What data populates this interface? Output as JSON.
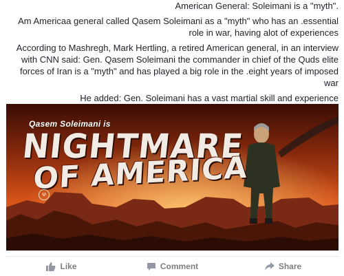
{
  "post": {
    "paragraphs": [
      ".\"American General: Soleimani is a \"myth",
      "Am Americaa general called Qasem Soleimani as a \"myth\" who has an .essential role in war, having alot of experiences",
      "According to Mashregh, Mark Hertling, a retired American general, in an interview with CNN said: Gen. Qasem Soleimani the commander in chief of the Quds elite forces of Iran is a \"myth\" and has played a big role in the .eight years of imposed war",
      "He added: Gen. Soleimani has a vast martial skill and experience"
    ]
  },
  "image": {
    "subtitle": "Qasem Soleimani is",
    "headline_line1": "NIGHTMARE",
    "headline_line2": "OF AMERICA"
  },
  "actions": {
    "like": "Like",
    "comment": "Comment",
    "share": "Share"
  },
  "colors": {
    "sky_dark": "#5a1406",
    "sky_orange": "#e0581a",
    "action_gray": "#7f7f7f"
  }
}
